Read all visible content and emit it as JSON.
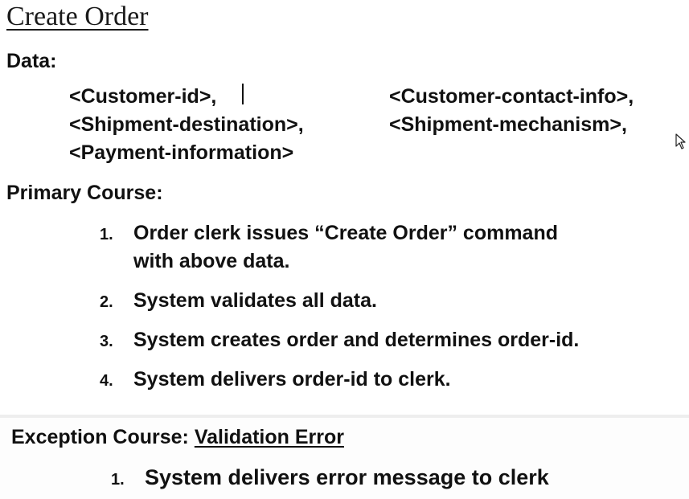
{
  "title": "Create Order",
  "data_section": {
    "heading": "Data:",
    "fields_left": [
      "<Customer-id>,",
      "<Shipment-destination>,",
      "<Payment-information>"
    ],
    "fields_right": [
      "<Customer-contact-info>,",
      "<Shipment-mechanism>,"
    ]
  },
  "primary_course": {
    "heading": "Primary Course:",
    "steps": [
      {
        "number": "1.",
        "line1": "Order clerk  issues “Create Order” command",
        "line2": "with above data."
      },
      {
        "number": "2.",
        "line1": "System validates all data."
      },
      {
        "number": "3.",
        "line1": "System creates order and determines order-id."
      },
      {
        "number": "4.",
        "line1": "System delivers order-id to clerk."
      }
    ]
  },
  "exception_course": {
    "heading_prefix": "Exception Course: ",
    "heading_name": "Validation Error",
    "steps": [
      {
        "number": "1.",
        "text": "System delivers error message to clerk"
      }
    ]
  },
  "icons": {
    "text_cursor": "text-cursor-icon",
    "mouse_pointer": "mouse-pointer-icon"
  }
}
